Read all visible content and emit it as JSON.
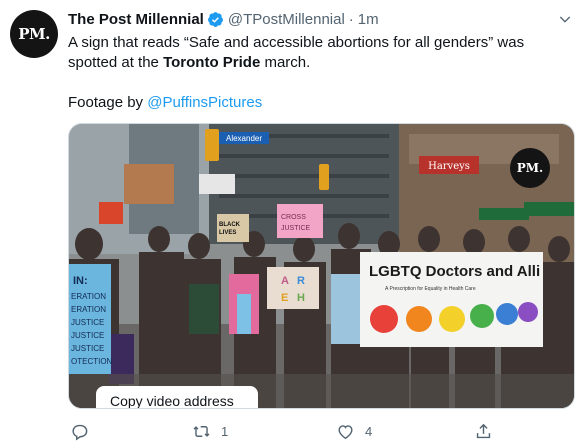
{
  "author": {
    "avatar_text": "PM.",
    "name": "The Post Millennial",
    "handle": "@TPostMillennial",
    "separator": "·",
    "time": "1m",
    "verified": true
  },
  "tweet": {
    "text_part1": "A sign that reads “Safe and accessible abortions for all genders” was spotted at the ",
    "text_bold": "Toronto Pride",
    "text_part2": " march.",
    "footage_prefix": "Footage by ",
    "footage_link": "@PuffinsPictures"
  },
  "media": {
    "watermark": "PM.",
    "copy_label": "Copy video address",
    "banner_text": "LGBTQ Doctors and Alli",
    "banner_subtext": "A Prescription for Equality in Health Care",
    "street_sign": "Alexander",
    "sign_left": "IN: ERATION ERATION JUSTICE JUSTICE JUSTICE OTECTION",
    "sign_center": "A R E H",
    "sign_pink": "CROSS JUSTICE",
    "sign_black": "BLACK LIVES MATTER",
    "store_sign": "Harveys"
  },
  "actions": {
    "reply_count": "",
    "retweet_count": "1",
    "like_count": "4"
  },
  "colors": {
    "accent": "#1d9bf0",
    "muted": "#536471",
    "text": "#0f1419"
  }
}
